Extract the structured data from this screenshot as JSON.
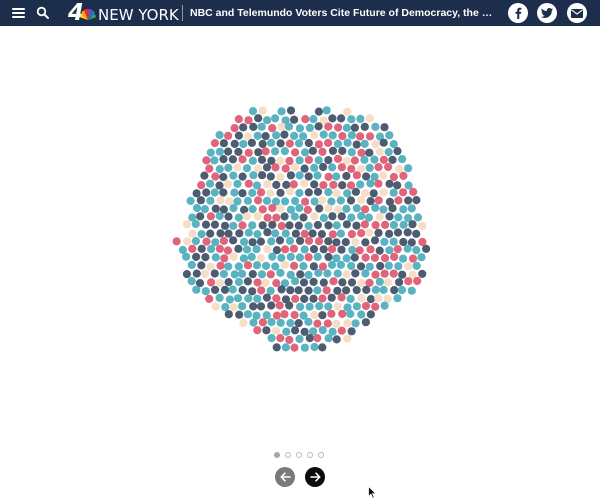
{
  "header": {
    "logo_number": "4",
    "logo_city": "NEW YORK",
    "headline": "NBC and Telemundo Voters Cite Future of Democracy, the Economy and Abortion",
    "icons": [
      "menu-icon",
      "search-icon",
      "facebook-icon",
      "twitter-icon",
      "email-icon"
    ],
    "background_color": "#1d2e4c"
  },
  "visualization": {
    "colors": {
      "teal": "#5ab3c1",
      "navy": "#4d5c70",
      "pink": "#e0647a",
      "cream": "#f6ddc5"
    }
  },
  "pager": {
    "total": 5,
    "active_index": 0
  },
  "nav": {
    "prev_icon": "arrow-left-icon",
    "next_icon": "arrow-right-icon"
  }
}
